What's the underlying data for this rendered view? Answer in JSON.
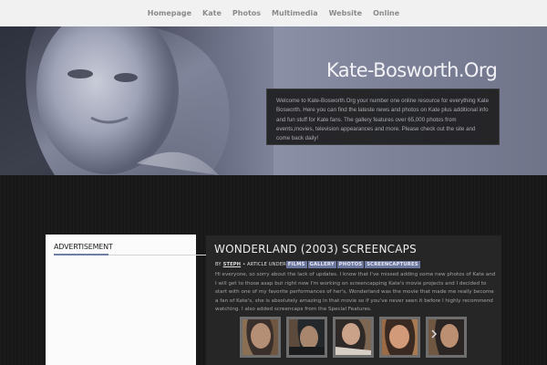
{
  "nav": {
    "items": [
      "Homepage",
      "Kate",
      "Photos",
      "Multimedia",
      "Website",
      "Online"
    ]
  },
  "hero": {
    "site_title": "Kate-Bosworth.Org",
    "intro": "Welcome to Kate-Bosworth.Org your number one online resource for everything Kate Bosworth. Here you can find the lateste news and photos on Kate plus additional info and fun stuff for Kate fans. The gallery features over 65,000 photos from events,movies, television appearances and more. Please check out the site and come back daily!"
  },
  "sidebar": {
    "title": "ADVERTISEMENT"
  },
  "article": {
    "title": "WONDERLAND (2003) SCREENCAPS",
    "by_label": "BY",
    "author": "STEPH",
    "under_label": "• ARTICLE UNDER",
    "tags": [
      "FILMS",
      "GALLERY",
      "PHOTOS",
      "SCREENCAPTURES"
    ],
    "body": "Hi everyone, so sorry about the lack of updates. I know that I've missed adding some new photos of Kate and I will get to those asap but right now I'm working on screencapping Kate's movie projects and I decided to start with one of my favorite performances of her's, Wonderland was the movie that made me really become a fan of Kate's, she is absolutely amazing in that movie so if you've never seen it before I highly recommend watching. I also added screencaps from the Special Features.",
    "thumbnails": [
      {
        "name": "screencap-1"
      },
      {
        "name": "screencap-2"
      },
      {
        "name": "screencap-3"
      },
      {
        "name": "screencap-4"
      },
      {
        "name": "screencap-5"
      }
    ]
  },
  "colors": {
    "nav_bg": "#f1f1f1",
    "tag_bg": "#6c77a0",
    "panel_bg": "#262626",
    "page_bg": "#161616"
  }
}
